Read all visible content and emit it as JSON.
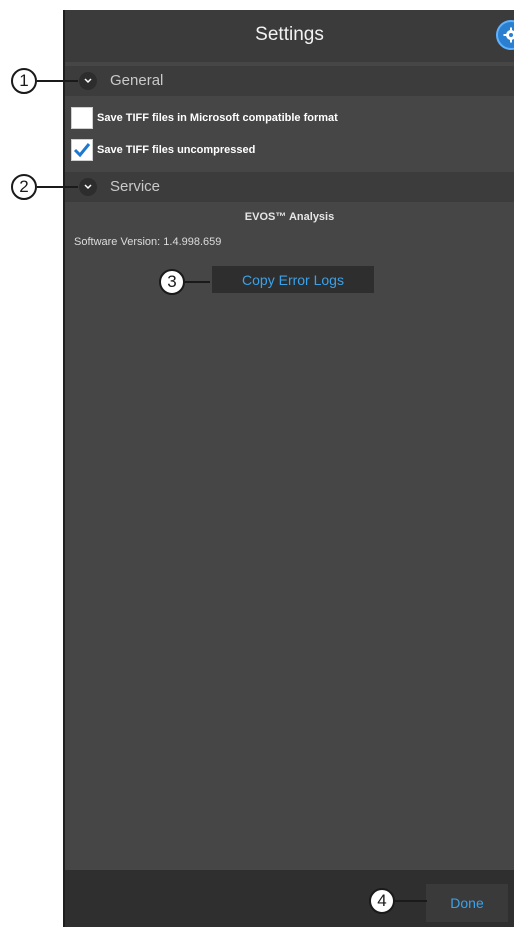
{
  "header": {
    "title": "Settings",
    "settings_icon": "gear-icon",
    "accent": "#2a7fd0"
  },
  "sections": {
    "general": {
      "label": "General"
    },
    "service": {
      "label": "Service"
    }
  },
  "options": [
    {
      "label": "Save TIFF files in Microsoft compatible format",
      "checked": false
    },
    {
      "label": "Save TIFF files uncompressed",
      "checked": true
    }
  ],
  "service": {
    "product": "EVOS™ Analysis",
    "version_label": "Software Version:",
    "version_value": "1.4.998.659",
    "copy_logs_label": "Copy Error Logs"
  },
  "footer": {
    "done_label": "Done"
  },
  "callouts": [
    "1",
    "2",
    "3",
    "4"
  ]
}
